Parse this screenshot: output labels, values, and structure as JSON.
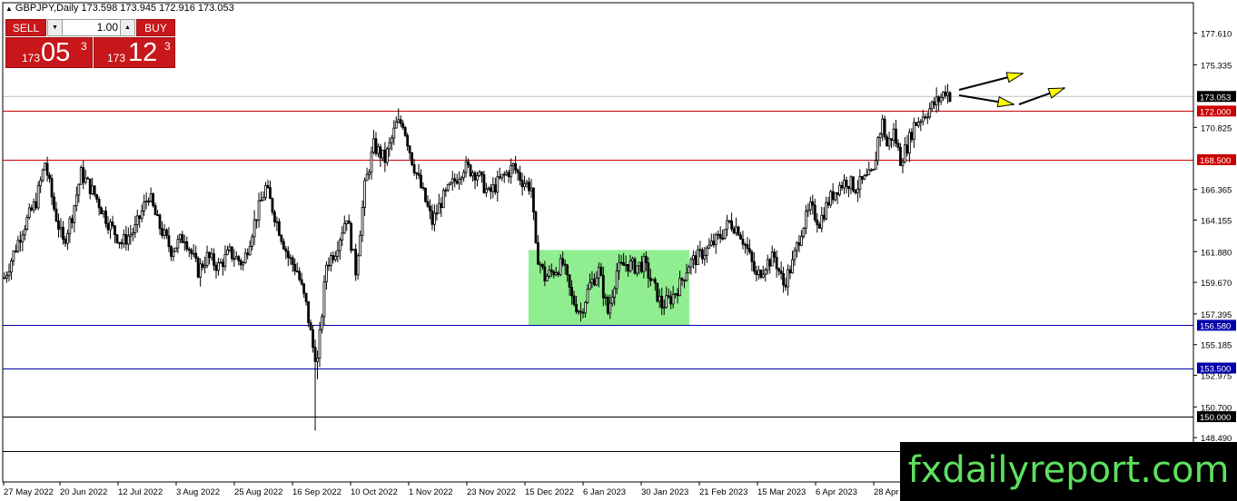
{
  "header": {
    "symbol_line": "GBPJPY,Daily  173.598 173.945 172.916 173.053"
  },
  "trade_panel": {
    "sell_label": "SELL",
    "buy_label": "BUY",
    "volume": "1.00",
    "sell_price": {
      "prefix": "173",
      "big": "05",
      "sup": "3"
    },
    "buy_price": {
      "prefix": "173",
      "big": "12",
      "sup": "3"
    }
  },
  "watermark": "fxdailyreport.com",
  "chart_data": {
    "type": "candlestick",
    "symbol": "GBPJPY",
    "timeframe": "Daily",
    "ohlc_current": {
      "open": 173.598,
      "high": 173.945,
      "low": 172.916,
      "close": 173.053
    },
    "y_ticks": [
      "177.610",
      "175.335",
      "170.825",
      "166.365",
      "164.155",
      "161.880",
      "159.670",
      "157.395",
      "155.185",
      "152.975",
      "150.700",
      "148.490"
    ],
    "x_ticks": [
      "27 May 2022",
      "20 Jun 2022",
      "12 Jul 2022",
      "3 Aug 2022",
      "25 Aug 2022",
      "16 Sep 2022",
      "10 Oct 2022",
      "1 Nov 2022",
      "23 Nov 2022",
      "15 Dec 2022",
      "6 Jan 2023",
      "30 Jan 2023",
      "21 Feb 2023",
      "15 Mar 2023",
      "6 Apr 2023",
      "28 Apr"
    ],
    "ylim": [
      145.3,
      179.8
    ],
    "horizontal_levels": [
      {
        "label": "172.000",
        "value": 172.0,
        "color": "#cc0000"
      },
      {
        "label": "168.500",
        "value": 168.5,
        "color": "#cc0000"
      },
      {
        "label": "156.580",
        "value": 156.58,
        "color": "#0000aa"
      },
      {
        "label": "153.500",
        "value": 153.5,
        "color": "#0000aa"
      },
      {
        "label": "150.000",
        "value": 150.0,
        "color": "#000000"
      },
      {
        "label": "147.500",
        "value": 147.5,
        "color": "#000000"
      }
    ],
    "current_price": {
      "label": "173.053",
      "value": 173.053
    },
    "range_zone": {
      "from_date": "15 Dec 2022",
      "to_date": "3 Feb 2023",
      "low": 156.6,
      "high": 162.0,
      "color": "#90ee90"
    },
    "path_keypoints": [
      [
        0,
        160.0
      ],
      [
        8,
        163.5
      ],
      [
        14,
        165.5
      ],
      [
        18,
        168.3
      ],
      [
        22,
        165.0
      ],
      [
        26,
        162.5
      ],
      [
        30,
        164.5
      ],
      [
        34,
        167.5
      ],
      [
        40,
        166.0
      ],
      [
        46,
        164.0
      ],
      [
        52,
        162.5
      ],
      [
        58,
        163.5
      ],
      [
        64,
        166.0
      ],
      [
        68,
        164.0
      ],
      [
        74,
        162.0
      ],
      [
        80,
        163.0
      ],
      [
        86,
        160.5
      ],
      [
        90,
        161.5
      ],
      [
        95,
        160.8
      ],
      [
        100,
        161.8
      ],
      [
        106,
        161.0
      ],
      [
        111,
        164.0
      ],
      [
        116,
        166.5
      ],
      [
        121,
        164.0
      ],
      [
        126,
        161.5
      ],
      [
        130,
        160.5
      ],
      [
        134,
        158.0
      ],
      [
        137,
        155.0
      ],
      [
        139,
        154.0
      ],
      [
        143,
        161.0
      ],
      [
        147,
        162.0
      ],
      [
        152,
        164.5
      ],
      [
        156,
        160.5
      ],
      [
        160,
        166.5
      ],
      [
        164,
        169.5
      ],
      [
        169,
        168.5
      ],
      [
        174,
        171.0
      ],
      [
        177,
        171.2
      ],
      [
        181,
        168.5
      ],
      [
        185,
        166.5
      ],
      [
        190,
        164.0
      ],
      [
        194,
        165.5
      ],
      [
        198,
        166.5
      ],
      [
        204,
        168.0
      ],
      [
        210,
        167.5
      ],
      [
        215,
        166.0
      ],
      [
        220,
        167.0
      ],
      [
        226,
        168.0
      ],
      [
        230,
        167.0
      ],
      [
        234,
        166.5
      ],
      [
        236,
        162.0
      ],
      [
        240,
        160.0
      ],
      [
        244,
        160.5
      ],
      [
        248,
        161.0
      ],
      [
        252,
        158.5
      ],
      [
        256,
        157.5
      ],
      [
        260,
        159.5
      ],
      [
        264,
        160.5
      ],
      [
        268,
        157.5
      ],
      [
        272,
        160.5
      ],
      [
        276,
        161.0
      ],
      [
        280,
        160.8
      ],
      [
        284,
        161.0
      ],
      [
        288,
        159.5
      ],
      [
        292,
        158.0
      ],
      [
        296,
        158.5
      ],
      [
        300,
        159.5
      ],
      [
        304,
        161.0
      ],
      [
        308,
        161.5
      ],
      [
        312,
        162.0
      ],
      [
        318,
        163.0
      ],
      [
        322,
        164.0
      ],
      [
        326,
        163.5
      ],
      [
        330,
        162.0
      ],
      [
        334,
        160.0
      ],
      [
        338,
        161.0
      ],
      [
        342,
        161.5
      ],
      [
        346,
        159.5
      ],
      [
        350,
        161.0
      ],
      [
        354,
        163.5
      ],
      [
        358,
        165.0
      ],
      [
        362,
        164.0
      ],
      [
        366,
        165.5
      ],
      [
        370,
        166.5
      ],
      [
        374,
        167.0
      ],
      [
        378,
        166.5
      ],
      [
        382,
        167.0
      ],
      [
        386,
        167.5
      ],
      [
        388,
        170.0
      ],
      [
        390,
        171.2
      ],
      [
        392,
        169.5
      ],
      [
        395,
        170.5
      ],
      [
        398,
        168.5
      ],
      [
        401,
        169.5
      ],
      [
        404,
        171.0
      ],
      [
        407,
        171.5
      ],
      [
        410,
        172.0
      ],
      [
        413,
        172.5
      ],
      [
        416,
        173.0
      ],
      [
        418,
        173.5
      ],
      [
        420,
        173.1
      ]
    ],
    "annotations": [
      {
        "type": "arrow",
        "color": "#ffff00"
      },
      {
        "type": "arrow",
        "color": "#ffff00"
      },
      {
        "type": "arrow",
        "color": "#ffff00"
      }
    ]
  }
}
